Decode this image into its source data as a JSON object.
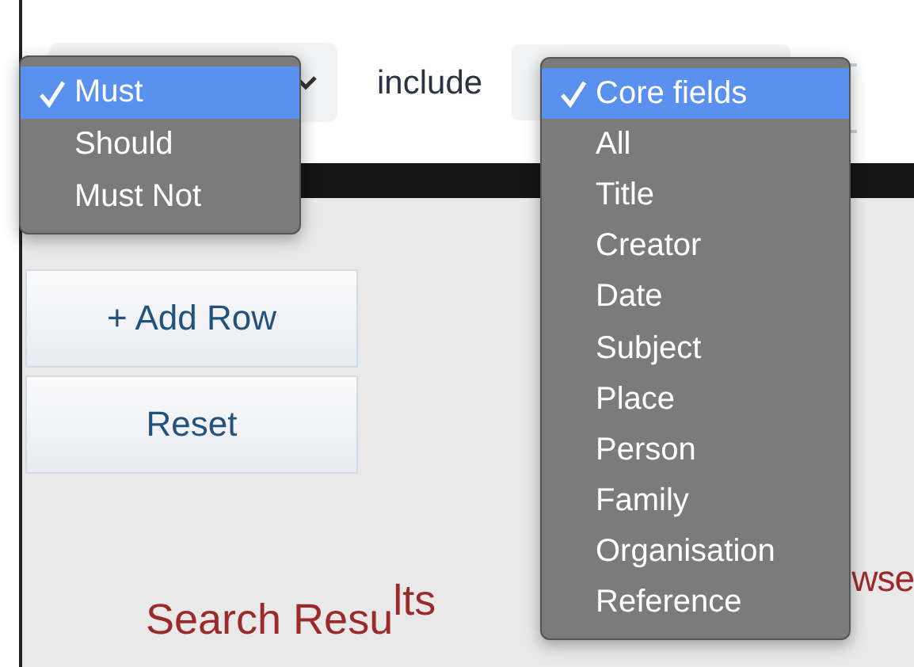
{
  "query_row": {
    "operator_menu": {
      "options": [
        {
          "label": "Must",
          "selected": true
        },
        {
          "label": "Should",
          "selected": false
        },
        {
          "label": "Must Not",
          "selected": false
        }
      ]
    },
    "include_label": "include",
    "field_menu": {
      "options": [
        {
          "label": "Core fields",
          "selected": true
        },
        {
          "label": "All",
          "selected": false
        },
        {
          "label": "Title",
          "selected": false
        },
        {
          "label": "Creator",
          "selected": false
        },
        {
          "label": "Date",
          "selected": false
        },
        {
          "label": "Subject",
          "selected": false
        },
        {
          "label": "Place",
          "selected": false
        },
        {
          "label": "Person",
          "selected": false
        },
        {
          "label": "Family",
          "selected": false
        },
        {
          "label": "Organisation",
          "selected": false
        },
        {
          "label": "Reference",
          "selected": false
        }
      ]
    }
  },
  "buttons": [
    "+ Add Row",
    "Reset"
  ],
  "headings": [
    "Search Resu$^{lts}$",
    "wse"
  ]
}
